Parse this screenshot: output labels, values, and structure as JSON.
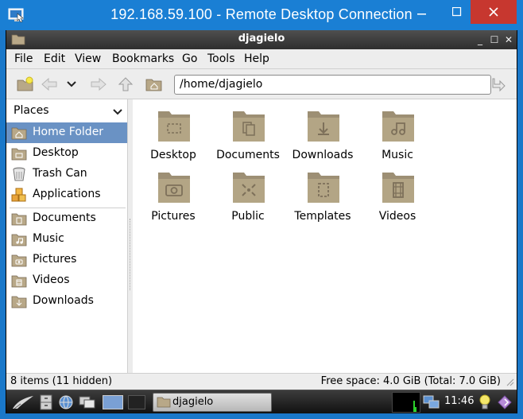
{
  "rdp": {
    "title": "192.168.59.100 - Remote Desktop Connection",
    "min_glyph": "—",
    "max_glyph": "☐",
    "close_glyph": "✕"
  },
  "window": {
    "title": "djagielo",
    "wm_minimize": "_",
    "wm_maximize": "☐",
    "wm_close": "✕"
  },
  "menu": [
    "File",
    "Edit",
    "View",
    "Bookmarks",
    "Go",
    "Tools",
    "Help"
  ],
  "location": {
    "path": "/home/djagielo"
  },
  "sidebar": {
    "header": "Places",
    "places": [
      {
        "label": "Home Folder",
        "icon": "home-folder-icon",
        "selected": true
      },
      {
        "label": "Desktop",
        "icon": "desktop-icon"
      },
      {
        "label": "Trash Can",
        "icon": "trash-icon"
      },
      {
        "label": "Applications",
        "icon": "applications-icon"
      }
    ],
    "bookmarks": [
      {
        "label": "Documents",
        "icon": "folder-documents-icon"
      },
      {
        "label": "Music",
        "icon": "folder-music-icon"
      },
      {
        "label": "Pictures",
        "icon": "folder-pictures-icon"
      },
      {
        "label": "Videos",
        "icon": "folder-videos-icon"
      },
      {
        "label": "Downloads",
        "icon": "folder-downloads-icon"
      }
    ]
  },
  "files": [
    {
      "label": "Desktop",
      "icon": "folder-desktop-icon"
    },
    {
      "label": "Documents",
      "icon": "folder-documents-icon"
    },
    {
      "label": "Downloads",
      "icon": "folder-downloads-icon"
    },
    {
      "label": "Music",
      "icon": "folder-music-icon"
    },
    {
      "label": "Pictures",
      "icon": "folder-pictures-icon"
    },
    {
      "label": "Public",
      "icon": "folder-public-icon"
    },
    {
      "label": "Templates",
      "icon": "folder-templates-icon"
    },
    {
      "label": "Videos",
      "icon": "folder-videos-icon"
    }
  ],
  "status": {
    "items": "8 items (11 hidden)",
    "free_space": "Free space: 4.0 GiB (Total: 7.0 GiB)"
  },
  "taskbar": {
    "window_label": "djagielo",
    "clock": "11:46"
  },
  "colors": {
    "rdp_blue": "#1a7fd4",
    "selection": "#6a92c4",
    "folder_brown": "#a89a7d"
  }
}
